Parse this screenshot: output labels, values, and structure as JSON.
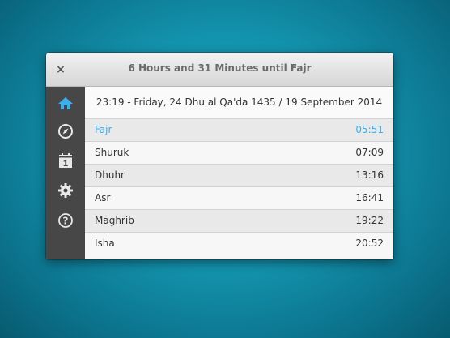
{
  "window": {
    "title": "6 Hours and 31 Minutes until Fajr",
    "close_label": "×"
  },
  "sidebar": {
    "items": [
      {
        "icon": "home-icon",
        "active": true
      },
      {
        "icon": "compass-icon",
        "active": false
      },
      {
        "icon": "calendar-icon",
        "active": false,
        "badge": "1"
      },
      {
        "icon": "gear-icon",
        "active": false
      },
      {
        "icon": "help-icon",
        "active": false
      }
    ]
  },
  "main": {
    "date_line": "23:19 - Friday, 24 Dhu al Qa'da 1435 / 19 September 2014",
    "prayers": [
      {
        "name": "Fajr",
        "time": "05:51",
        "highlighted": true
      },
      {
        "name": "Shuruk",
        "time": "07:09"
      },
      {
        "name": "Dhuhr",
        "time": "13:16"
      },
      {
        "name": "Asr",
        "time": "16:41"
      },
      {
        "name": "Maghrib",
        "time": "19:22"
      },
      {
        "name": "Isha",
        "time": "20:52"
      }
    ]
  },
  "colors": {
    "accent": "#3daee9",
    "sidebar_bg": "#474747",
    "icon": "#e8e8e8"
  }
}
